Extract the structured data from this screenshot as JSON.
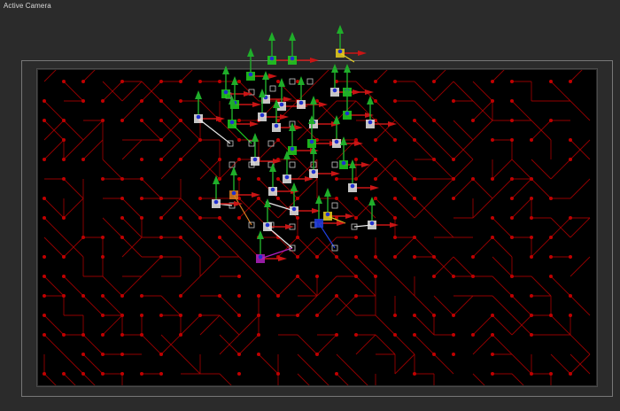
{
  "viewport": {
    "label": "Active Camera"
  },
  "colors": {
    "background": "#2b2b2b",
    "composition": "#000000",
    "grid": "#b00000",
    "grid_dot": "#c00000",
    "y_axis": "#1fae2a",
    "x_axis": "#c91515",
    "selection_green": "#20d020",
    "selection_yellow": "#e8d020",
    "selection_white": "#e8e8e8",
    "selection_orange": "#e08020",
    "selection_magenta": "#b020c0",
    "selection_blue": "#2040e0"
  },
  "icons": {
    "layer_handle": "layer-handle-icon",
    "y_axis_arrow": "y-axis-arrow-icon",
    "x_axis_arrow": "x-axis-arrow-icon",
    "anchor_point": "anchor-point-icon"
  }
}
